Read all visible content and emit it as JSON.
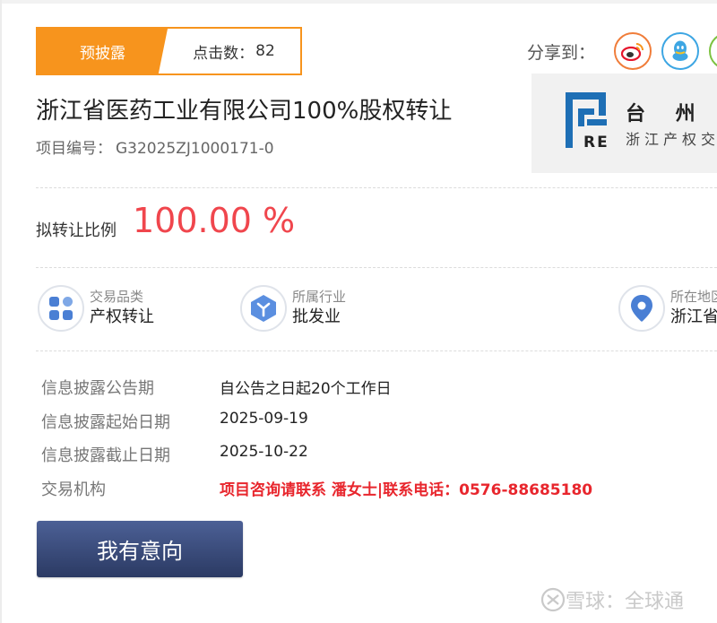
{
  "status": {
    "label": "预披露",
    "clicks_label": "点击数：",
    "clicks_value": "82"
  },
  "share": {
    "label": "分享到：",
    "icons": [
      "weibo-icon",
      "qq-icon",
      "wechat-icon"
    ],
    "colors": {
      "weibo": "#f07d3a",
      "qq": "#3da6e3",
      "wechat": "#7cc240"
    }
  },
  "logo": {
    "mark_text": "RE",
    "name": "台 州 市",
    "sub": "浙江产权交"
  },
  "title": "浙江省医药工业有限公司100%股权转让",
  "project_no": {
    "label": "项目编号：",
    "value": "G32025ZJ1000171-0"
  },
  "ratio": {
    "label": "拟转让比例",
    "value": "100.00 %"
  },
  "info_items": [
    {
      "label": "交易品类",
      "value": "产权转让",
      "icon": "category-grid-icon"
    },
    {
      "label": "所属行业",
      "value": "批发业",
      "icon": "industry-icon"
    },
    {
      "label": "所在地区",
      "value": "浙江省",
      "icon": "location-pin-icon"
    }
  ],
  "details": [
    {
      "label": "信息披露公告期",
      "value": "自公告之日起20个工作日"
    },
    {
      "label": "信息披露起始日期",
      "value": "2025-09-19"
    },
    {
      "label": "信息披露截止日期",
      "value": "2025-10-22"
    },
    {
      "label": "交易机构",
      "value": "项目咨询请联系 潘女士|联系电话：0576-88685180"
    }
  ],
  "action_button": "我有意向",
  "watermark": {
    "brand": "雪球：全球通"
  },
  "colors": {
    "accent": "#f7941d",
    "highlight": "#f0464d",
    "contact": "#e8262d",
    "button": "#3a4b7c"
  }
}
